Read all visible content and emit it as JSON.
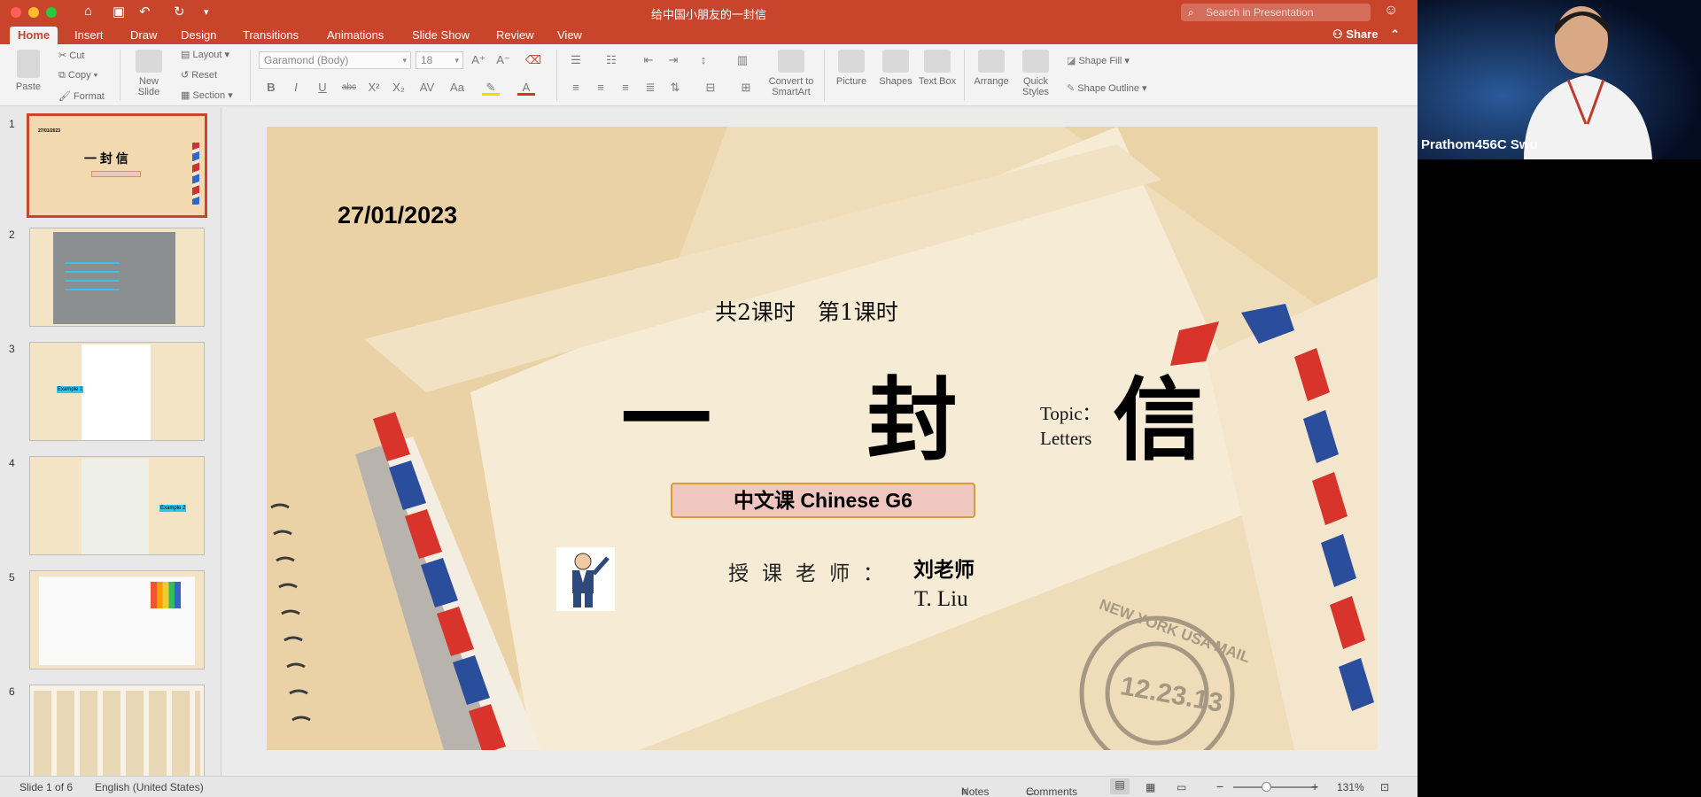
{
  "window": {
    "title": "给中国小朋友的一封信",
    "search_placeholder": "Search in Presentation",
    "share_label": "Share"
  },
  "tabs": [
    "Home",
    "Insert",
    "Draw",
    "Design",
    "Transitions",
    "Animations",
    "Slide Show",
    "Review",
    "View"
  ],
  "active_tab": "Home",
  "ribbon": {
    "paste": "Paste",
    "cut": "Cut",
    "copy": "Copy",
    "format": "Format",
    "new_slide": "New Slide",
    "layout": "Layout",
    "reset": "Reset",
    "section": "Section",
    "font_name": "Garamond (Body)",
    "font_size": "18",
    "convert_smartart": "Convert to SmartArt",
    "picture": "Picture",
    "shapes": "Shapes",
    "text_box": "Text Box",
    "arrange": "Arrange",
    "quick_styles": "Quick Styles",
    "shape_fill": "Shape Fill",
    "shape_outline": "Shape Outline"
  },
  "slides": [
    {
      "num": "1",
      "selected": true
    },
    {
      "num": "2",
      "selected": false
    },
    {
      "num": "3",
      "selected": false
    },
    {
      "num": "4",
      "selected": false
    },
    {
      "num": "5",
      "selected": false
    },
    {
      "num": "6",
      "selected": false
    }
  ],
  "thumb_text": {
    "t1_date": "27/01/2023",
    "t1_title": "一 封 信",
    "t3_example": "Example 1",
    "t4_example": "Example 2"
  },
  "slide": {
    "date": "27/01/2023",
    "period": "共2课时　第1课时",
    "title": "一 封 信",
    "topic_line1": "Topic：",
    "topic_line2": "Letters",
    "course": "中文课 Chinese G6",
    "teacher_label": "授课老师：",
    "teacher_name": "刘老师",
    "teacher_en": "T. Liu",
    "stamp_top": "NEW YORK USA MAIL",
    "stamp_date": "12.23.13"
  },
  "status": {
    "slide_info": "Slide 1 of 6",
    "language": "English (United States)",
    "notes": "Notes",
    "comments": "Comments",
    "zoom": "131%"
  },
  "webcam": {
    "participant": "Prathom456C Swu"
  },
  "colors": {
    "accent": "#c8452c"
  }
}
